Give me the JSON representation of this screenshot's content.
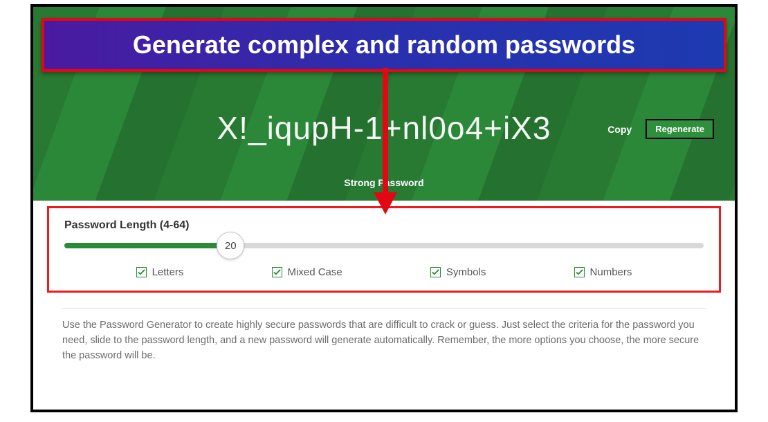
{
  "callout": {
    "text": "Generate complex and random passwords"
  },
  "hero": {
    "password": "X!_iqupH-1+nl0o4+iX3",
    "copy_label": "Copy",
    "regenerate_label": "Regenerate",
    "strength_label": "Strong Password"
  },
  "options": {
    "length_label": "Password Length (4-64)",
    "length_value": "20",
    "checks": {
      "letters": "Letters",
      "mixed": "Mixed Case",
      "symbols": "Symbols",
      "numbers": "Numbers"
    }
  },
  "description": "Use the Password Generator to create highly secure passwords that are difficult to crack or guess. Just select the criteria for the password you need, slide to the password length, and a new password will generate automatically. Remember, the more options you choose, the more secure the password will be."
}
